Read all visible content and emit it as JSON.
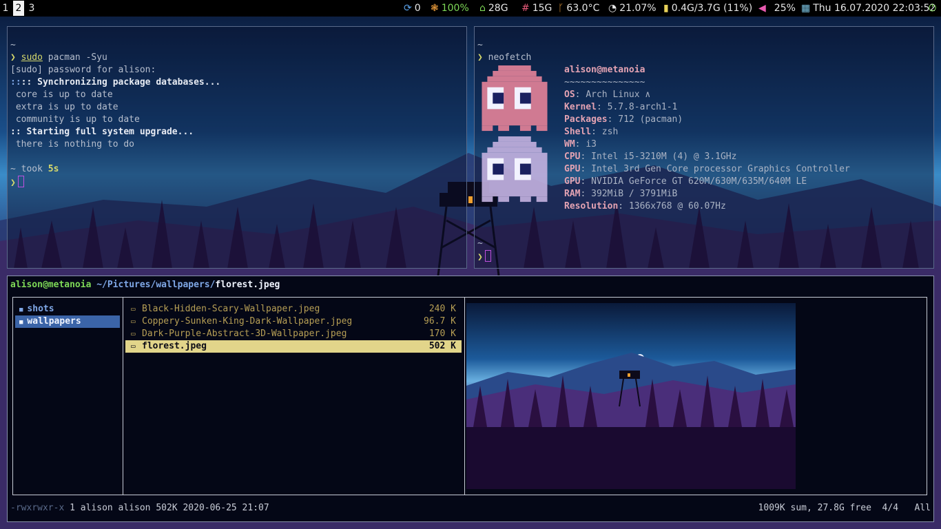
{
  "colors": {
    "accent_green": "#7ed957",
    "prompt_yellow": "#d7d96b",
    "ranger_dir_blue": "#7fa7e6",
    "ranger_selection_dir": "#3b64a8",
    "ranger_selection_file": "#e2d58a",
    "cursor_magenta": "#c050e0",
    "neofetch_pink": "#e4a3b3"
  },
  "bar": {
    "workspaces": [
      {
        "label": "1",
        "active": false
      },
      {
        "label": "2",
        "active": true
      },
      {
        "label": "3",
        "active": false
      }
    ],
    "modules": [
      {
        "icon": "sync-icon",
        "glyph": "⟳",
        "value": "0",
        "color": "#e6e6e6",
        "icon_color": "#5aa0e8"
      },
      {
        "icon": "battery-spark-icon",
        "glyph": "❃",
        "value": "100%",
        "color": "#7ed957",
        "icon_color": "#e89a3a"
      },
      {
        "icon": "home-disk-icon",
        "glyph": "⌂",
        "value": "28G",
        "color": "#e6e6e6",
        "icon_color": "#7ed957"
      },
      {
        "icon": "hash-disk-icon",
        "glyph": "#",
        "value": "15G",
        "color": "#e6e6e6",
        "icon_color": "#e85a7a"
      },
      {
        "icon": "thermometer-icon",
        "glyph": "🌡",
        "value": "63.0°C",
        "color": "#e6e6e6",
        "icon_color": "#e89a3a"
      },
      {
        "icon": "cpu-gauge-icon",
        "glyph": "◔",
        "value": "21.07%",
        "color": "#e6e6e6",
        "icon_color": "#e6e6e6"
      },
      {
        "icon": "memory-icon",
        "glyph": "▮",
        "value": "0.4G/3.7G (11%)",
        "color": "#e6e6e6",
        "icon_color": "#e8d25a"
      },
      {
        "icon": "volume-icon",
        "glyph": "◀",
        "value": "25%",
        "color": "#e6e6e6",
        "icon_color": "#e85ab0"
      },
      {
        "icon": "calendar-icon",
        "glyph": "▦",
        "value": "Thu 16.07.2020 22:03:52",
        "color": "#e6e6e6",
        "icon_color": "#7ec8e8"
      },
      {
        "icon": "power-icon",
        "glyph": "⏻",
        "value": "",
        "color": "#e6e6e6",
        "icon_color": "#7ed957"
      }
    ]
  },
  "term_left": {
    "home_tilde": "~",
    "prompt_symbol": "❯",
    "cmd_sudo": "sudo",
    "cmd_rest": " pacman -Syu",
    "lines": [
      "[sudo] password for alison:",
      ":: Synchronizing package databases...",
      " core is up to date",
      " extra is up to date",
      " community is up to date",
      ":: Starting full system upgrade...",
      " there is nothing to do"
    ],
    "took_prefix": "~ took ",
    "took_value": "5s"
  },
  "term_right": {
    "home_tilde": "~",
    "prompt_symbol": "❯",
    "cmd": "neofetch",
    "user_host": "alison@metanoia",
    "separator": "~~~~~~~~~~~~~~~",
    "info": [
      {
        "key": "OS",
        "value": "Arch Linux ∧"
      },
      {
        "key": "Kernel",
        "value": "5.7.8-arch1-1"
      },
      {
        "key": "Packages",
        "value": "712 (pacman)"
      },
      {
        "key": "Shell",
        "value": "zsh"
      },
      {
        "key": "WM",
        "value": "i3"
      },
      {
        "key": "CPU",
        "value": "Intel i5-3210M (4) @ 3.1GHz"
      },
      {
        "key": "GPU",
        "value": "Intel 3rd Gen Core processor Graphics Controller"
      },
      {
        "key": "GPU",
        "value": "NVIDIA GeForce GT 620M/630M/635M/640M LE"
      },
      {
        "key": "RAM",
        "value": "392MiB / 3791MiB"
      },
      {
        "key": "Resolution",
        "value": "1366x768 @ 60.07Hz"
      }
    ],
    "home_tilde_2": "~"
  },
  "ranger": {
    "user_host": "alison@metanoia",
    "path": " ~/Pictures/wallpapers/",
    "current_file": "florest.jpeg",
    "dirs": [
      {
        "name": "shots",
        "selected": false
      },
      {
        "name": "wallpapers",
        "selected": true
      }
    ],
    "files": [
      {
        "name": "Black-Hidden-Scary-Wallpaper.jpeg",
        "size": "240 K",
        "selected": false
      },
      {
        "name": "Coppery-Sunken-King-Dark-Wallpaper.jpeg",
        "size": "96.7 K",
        "selected": false
      },
      {
        "name": "Dark-Purple-Abstract-3D-Wallpaper.jpeg",
        "size": "170 K",
        "selected": false
      },
      {
        "name": "florest.jpeg",
        "size": "502 K",
        "selected": true
      }
    ],
    "file_icon": "▭",
    "dir_icon": "■",
    "status_perms": "-rwxrwxr-x",
    "status_meta": " 1 alison alison 502K 2020-06-25 21:07",
    "status_right": "1009K sum, 27.8G free  4/4   All"
  }
}
